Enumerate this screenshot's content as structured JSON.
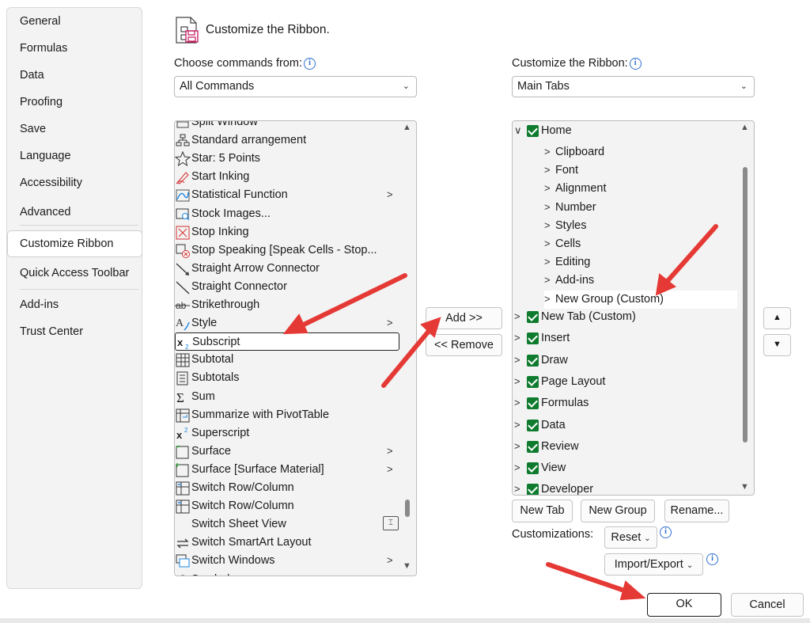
{
  "nav": {
    "items": [
      "General",
      "Formulas",
      "Data",
      "Proofing",
      "Save",
      "Language",
      "Accessibility",
      "Advanced",
      "Customize Ribbon",
      "Quick Access Toolbar",
      "Add-ins",
      "Trust Center"
    ],
    "selected": "Customize Ribbon"
  },
  "header": {
    "title": "Customize the Ribbon."
  },
  "left": {
    "label": "Choose commands from:",
    "selected": "All Commands",
    "commands": [
      {
        "label": "Split Window",
        "icon": "split-window-icon"
      },
      {
        "label": "Standard arrangement",
        "icon": "org-chart-icon"
      },
      {
        "label": "Star: 5 Points",
        "icon": "star-icon"
      },
      {
        "label": "Start Inking",
        "icon": "pen-icon"
      },
      {
        "label": "Statistical Function",
        "icon": "function-chart-icon",
        "submenu": ">"
      },
      {
        "label": "Stock Images...",
        "icon": "stock-images-icon"
      },
      {
        "label": "Stop Inking",
        "icon": "stop-inking-icon"
      },
      {
        "label": "Stop Speaking [Speak Cells - Stop...",
        "icon": "stop-speaking-icon"
      },
      {
        "label": "Straight Arrow Connector",
        "icon": "arrow-connector-icon"
      },
      {
        "label": "Straight Connector",
        "icon": "line-connector-icon"
      },
      {
        "label": "Strikethrough",
        "icon": "strikethrough-icon"
      },
      {
        "label": "Style",
        "icon": "style-icon",
        "submenu": ">"
      },
      {
        "label": "Subscript",
        "icon": "subscript-icon"
      },
      {
        "label": "Subtotal",
        "icon": "subtotal-icon"
      },
      {
        "label": "Subtotals",
        "icon": "subtotals-icon"
      },
      {
        "label": "Sum",
        "icon": "sum-icon"
      },
      {
        "label": "Summarize with PivotTable",
        "icon": "pivot-icon"
      },
      {
        "label": "Superscript",
        "icon": "superscript-icon"
      },
      {
        "label": "Surface",
        "icon": "surface-chart-icon",
        "submenu": ">"
      },
      {
        "label": "Surface [Surface Material]",
        "icon": "surface-material-icon",
        "submenu": ">"
      },
      {
        "label": "Switch Row/Column",
        "icon": "switch-row-column-icon"
      },
      {
        "label": "Switch Row/Column",
        "icon": "switch-row-column-icon"
      },
      {
        "label": "Switch Sheet View",
        "icon": "",
        "control": "sheet-view-dropdown-icon"
      },
      {
        "label": "Switch SmartArt Layout",
        "icon": "switch-layout-icon"
      },
      {
        "label": "Switch Windows",
        "icon": "switch-windows-icon",
        "submenu": ">"
      },
      {
        "label": "Symbol",
        "icon": "symbol-icon"
      }
    ],
    "selected_command": "Subscript"
  },
  "middle": {
    "add": "Add >>",
    "remove": "<< Remove"
  },
  "right": {
    "label": "Customize the Ribbon:",
    "selected": "Main Tabs",
    "tree": [
      {
        "label": "Home",
        "level": 0,
        "checked": true,
        "expanded": true
      },
      {
        "label": "Clipboard",
        "level": 1
      },
      {
        "label": "Font",
        "level": 1
      },
      {
        "label": "Alignment",
        "level": 1
      },
      {
        "label": "Number",
        "level": 1
      },
      {
        "label": "Styles",
        "level": 1
      },
      {
        "label": "Cells",
        "level": 1
      },
      {
        "label": "Editing",
        "level": 1
      },
      {
        "label": "Add-ins",
        "level": 1
      },
      {
        "label": "New Group (Custom)",
        "level": 1,
        "highlight": true
      },
      {
        "label": "New Tab (Custom)",
        "level": 0,
        "checked": true
      },
      {
        "label": "Insert",
        "level": 0,
        "checked": true
      },
      {
        "label": "Draw",
        "level": 0,
        "checked": true
      },
      {
        "label": "Page Layout",
        "level": 0,
        "checked": true
      },
      {
        "label": "Formulas",
        "level": 0,
        "checked": true
      },
      {
        "label": "Data",
        "level": 0,
        "checked": true
      },
      {
        "label": "Review",
        "level": 0,
        "checked": true
      },
      {
        "label": "View",
        "level": 0,
        "checked": true
      },
      {
        "label": "Developer",
        "level": 0,
        "checked": true
      }
    ],
    "new_tab": "New Tab",
    "new_group": "New Group",
    "rename": "Rename...",
    "customizations_label": "Customizations:",
    "reset": "Reset",
    "import_export": "Import/Export"
  },
  "footer": {
    "ok": "OK",
    "cancel": "Cancel"
  },
  "colors": {
    "accent": "#0f7b2e",
    "annotation": "#e53935",
    "info": "#2f6fd0"
  }
}
